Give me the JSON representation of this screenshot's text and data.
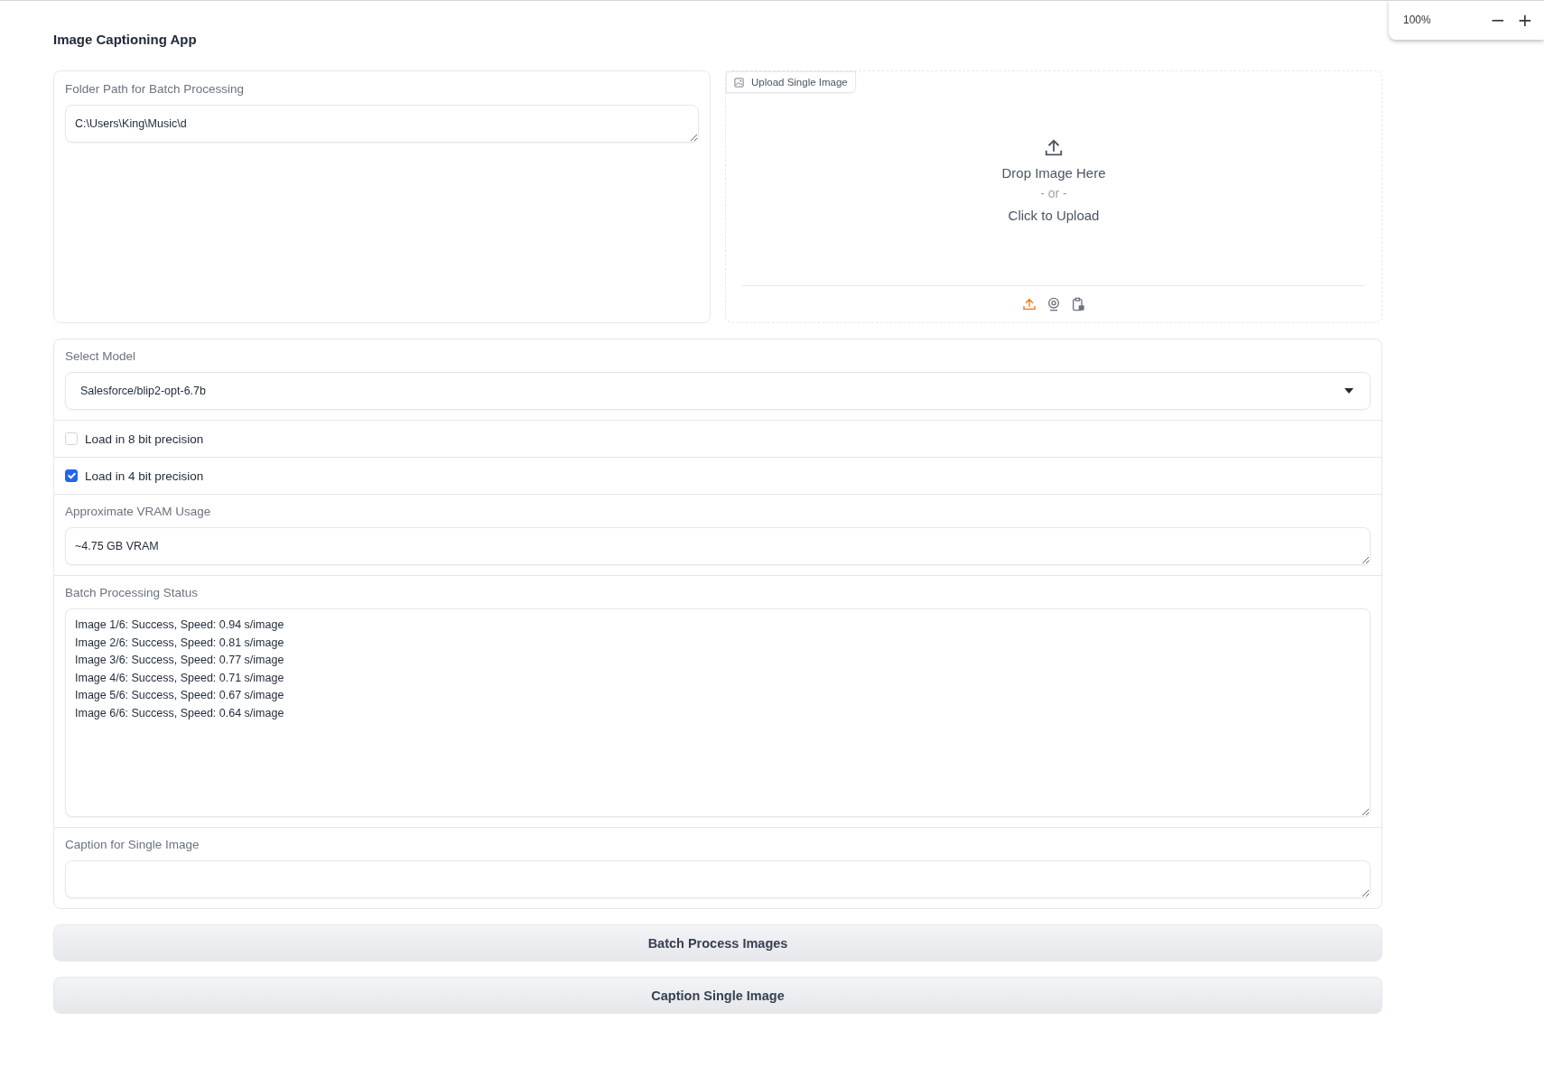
{
  "zoom_popup": {
    "level_text": "100%",
    "zoom_out": "−",
    "zoom_in": "+"
  },
  "title": "Image Captioning App",
  "folder": {
    "label": "Folder Path for Batch Processing",
    "value": "C:\\Users\\King\\Music\\d"
  },
  "upload": {
    "label": "Upload Single Image",
    "drop_text": "Drop Image Here",
    "or_text": "- or -",
    "click_text": "Click to Upload",
    "sources": [
      {
        "kind": "upload",
        "selected": true
      },
      {
        "kind": "webcam",
        "selected": false
      },
      {
        "kind": "clipboard",
        "selected": false
      }
    ]
  },
  "model": {
    "label": "Select Model",
    "value": "Salesforce/blip2-opt-6.7b"
  },
  "options": [
    {
      "label": "Load in 8 bit precision",
      "checked": false
    },
    {
      "label": "Load in 4 bit precision",
      "checked": true
    }
  ],
  "vram": {
    "label": "Approximate VRAM Usage",
    "value": "~4.75 GB VRAM"
  },
  "status": {
    "label": "Batch Processing Status",
    "lines": [
      "Image 1/6: Success, Speed: 0.94 s/image",
      "Image 2/6: Success, Speed: 0.81 s/image",
      "Image 3/6: Success, Speed: 0.77 s/image",
      "Image 4/6: Success, Speed: 0.71 s/image",
      "Image 5/6: Success, Speed: 0.67 s/image",
      "Image 6/6: Success, Speed: 0.64 s/image"
    ]
  },
  "caption": {
    "label": "Caption for Single Image"
  },
  "buttons": [
    "Batch Process Images",
    "Caption Single Image"
  ]
}
